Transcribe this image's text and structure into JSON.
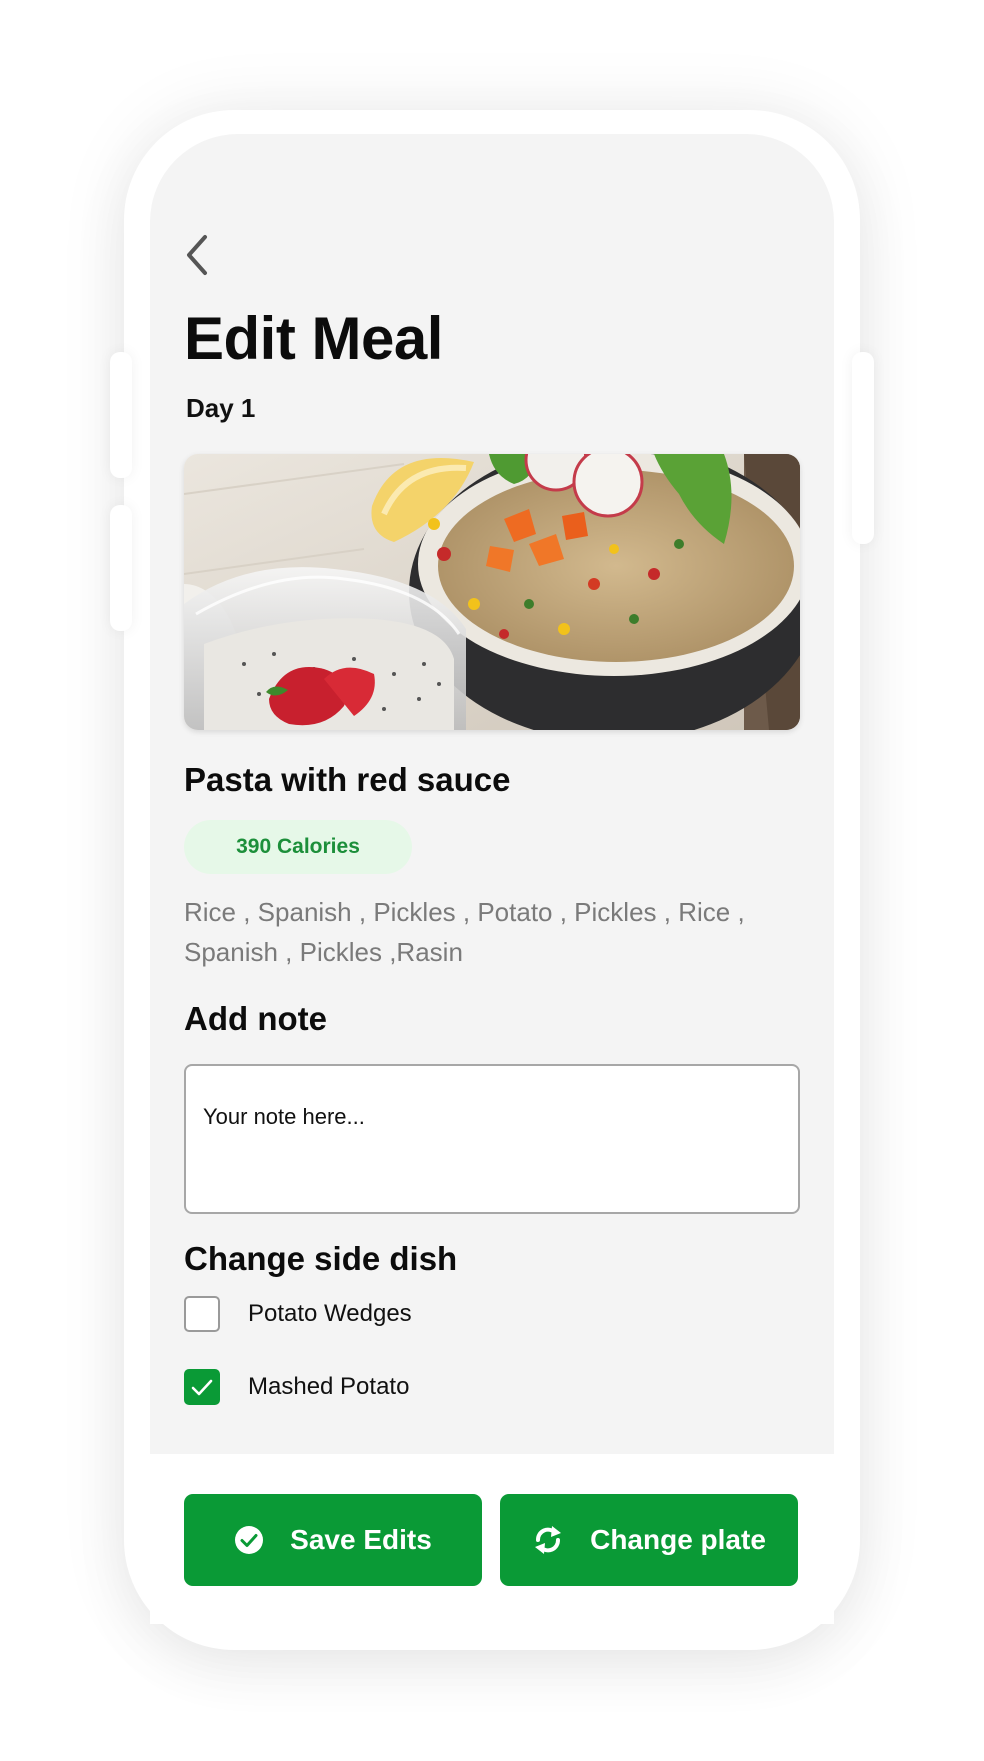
{
  "header": {
    "back_icon": "chevron-left-icon",
    "title": "Edit Meal",
    "subtitle": "Day 1"
  },
  "meal": {
    "image": "quinoa-salad-bowl-photo",
    "name": "Pasta with red sauce",
    "calories_label": "390 Calories",
    "ingredients": "Rice , Spanish , Pickles , Potato , Pickles , Rice , Spanish , Pickles ,Rasin"
  },
  "note": {
    "heading": "Add note",
    "placeholder": "Your note here...",
    "value": ""
  },
  "side_dish": {
    "heading": "Change side dish",
    "options": [
      {
        "label": "Potato Wedges",
        "checked": false
      },
      {
        "label": "Mashed Potato",
        "checked": true
      }
    ]
  },
  "actions": {
    "save_label": "Save Edits",
    "save_icon": "check-circle-icon",
    "change_label": "Change plate",
    "change_icon": "refresh-icon"
  },
  "colors": {
    "accent": "#0a9a36",
    "pill_bg": "#e6f8e8",
    "pill_text": "#1c8f3a",
    "screen_bg": "#f4f4f4",
    "muted_text": "#7a7a7a"
  }
}
